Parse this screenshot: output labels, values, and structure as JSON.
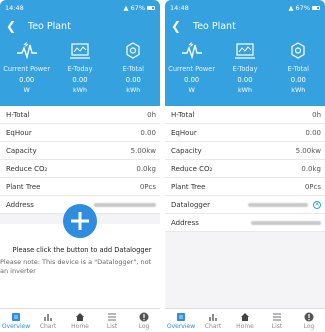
{
  "colors": {
    "header": "#35a2df",
    "accent": "#2f8de0"
  },
  "status_bar": {
    "time": "14:48",
    "battery": "67%"
  },
  "header": {
    "back_icon": "chevron-left-icon",
    "title": "Teo Plant"
  },
  "summary": [
    {
      "icon": "power-pulse-icon",
      "label": "Current Power",
      "value": "0.00",
      "unit": "W"
    },
    {
      "icon": "calendar-chart-icon",
      "label": "E-Today",
      "value": "0.00",
      "unit": "kWh"
    },
    {
      "icon": "gear-icon",
      "label": "E-Total",
      "value": "0.00",
      "unit": "kWh"
    }
  ],
  "left_screen": {
    "rows": [
      {
        "label": "H-Total",
        "value": "0h"
      },
      {
        "label": "EqHour",
        "value": "0.00"
      },
      {
        "label": "Capacity",
        "value": "5.00kw"
      },
      {
        "label": "Reduce CO₂",
        "value": "0.0kg"
      },
      {
        "label": "Plant Tree",
        "value": "0Pcs"
      },
      {
        "label": "Address",
        "value": ""
      }
    ],
    "add_hint": "Please click the button to add Datalogger",
    "note": "Please note: This device is a \"Datalogger\", not an inverter"
  },
  "right_screen": {
    "rows": [
      {
        "label": "H-Total",
        "value": "0h"
      },
      {
        "label": "EqHour",
        "value": "0.00"
      },
      {
        "label": "Capacity",
        "value": "5.00kw"
      },
      {
        "label": "Reduce CO₂",
        "value": "0.0kg"
      },
      {
        "label": "Plant Tree",
        "value": "0Pcs"
      },
      {
        "label": "Datalogger",
        "value": ""
      },
      {
        "label": "Address",
        "value": ""
      }
    ]
  },
  "tabs": [
    {
      "icon": "overview-icon",
      "label": "Overview",
      "active": true
    },
    {
      "icon": "bar-chart-icon",
      "label": "Chart",
      "active": false
    },
    {
      "icon": "home-icon",
      "label": "Home",
      "active": false
    },
    {
      "icon": "list-icon",
      "label": "List",
      "active": false
    },
    {
      "icon": "info-icon",
      "label": "Log",
      "active": false
    }
  ]
}
